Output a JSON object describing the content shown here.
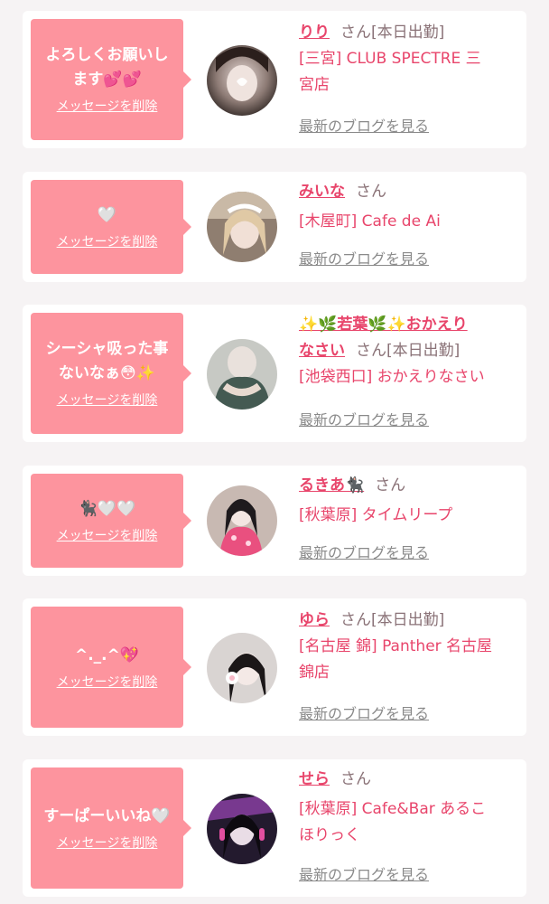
{
  "colors": {
    "accent": "#e8456b",
    "bubble": "#fd949e",
    "muted": "#8a7277",
    "background": "#f6f3f4"
  },
  "entries": [
    {
      "message_line1": "よろしくお願いし",
      "message_line2": "ます💕💕",
      "delete_label": "メッセージを削除",
      "name": "りり",
      "san": "さん",
      "badge": "[本日出勤]",
      "shop_line1": "[三宮] CLUB SPECTRE 三",
      "shop_line2": "宮店",
      "blog_label": "最新のブログを見る"
    },
    {
      "message_line1": "🤍",
      "delete_label": "メッセージを削除",
      "name": "みいな",
      "san": "さん",
      "badge": "",
      "shop_line1": "[木屋町] Cafe de Ai",
      "blog_label": "最新のブログを見る"
    },
    {
      "message_line1": "シーシャ吸った事",
      "message_line2": "ないなぁ😳✨",
      "delete_label": "メッセージを削除",
      "name_line1": "✨🌿若葉🌿✨おかえり",
      "name_line2": "なさい",
      "san": "さん",
      "badge": "[本日出勤]",
      "shop_line1": "[池袋西口] おかえりなさい",
      "blog_label": "最新のブログを見る"
    },
    {
      "message_line1": "🐈‍⬛🤍🤍",
      "delete_label": "メッセージを削除",
      "name": "るきあ🐈‍⬛",
      "san": "さん",
      "badge": "",
      "shop_line1": "[秋葉原] タイムリープ",
      "blog_label": "最新のブログを見る"
    },
    {
      "message_line1": "^._.^💖",
      "delete_label": "メッセージを削除",
      "name": "ゆら",
      "san": "さん",
      "badge": "[本日出勤]",
      "shop_line1": "[名古屋 錦] Panther 名古屋",
      "shop_line2": "錦店",
      "blog_label": "最新のブログを見る"
    },
    {
      "message_line1": "すーぱーいいね🤍",
      "delete_label": "メッセージを削除",
      "name": "せら",
      "san": "さん",
      "badge": "",
      "shop_line1": "[秋葉原] Cafe&Bar あるこ",
      "shop_line2": "ほりっく",
      "blog_label": "最新のブログを見る"
    }
  ]
}
